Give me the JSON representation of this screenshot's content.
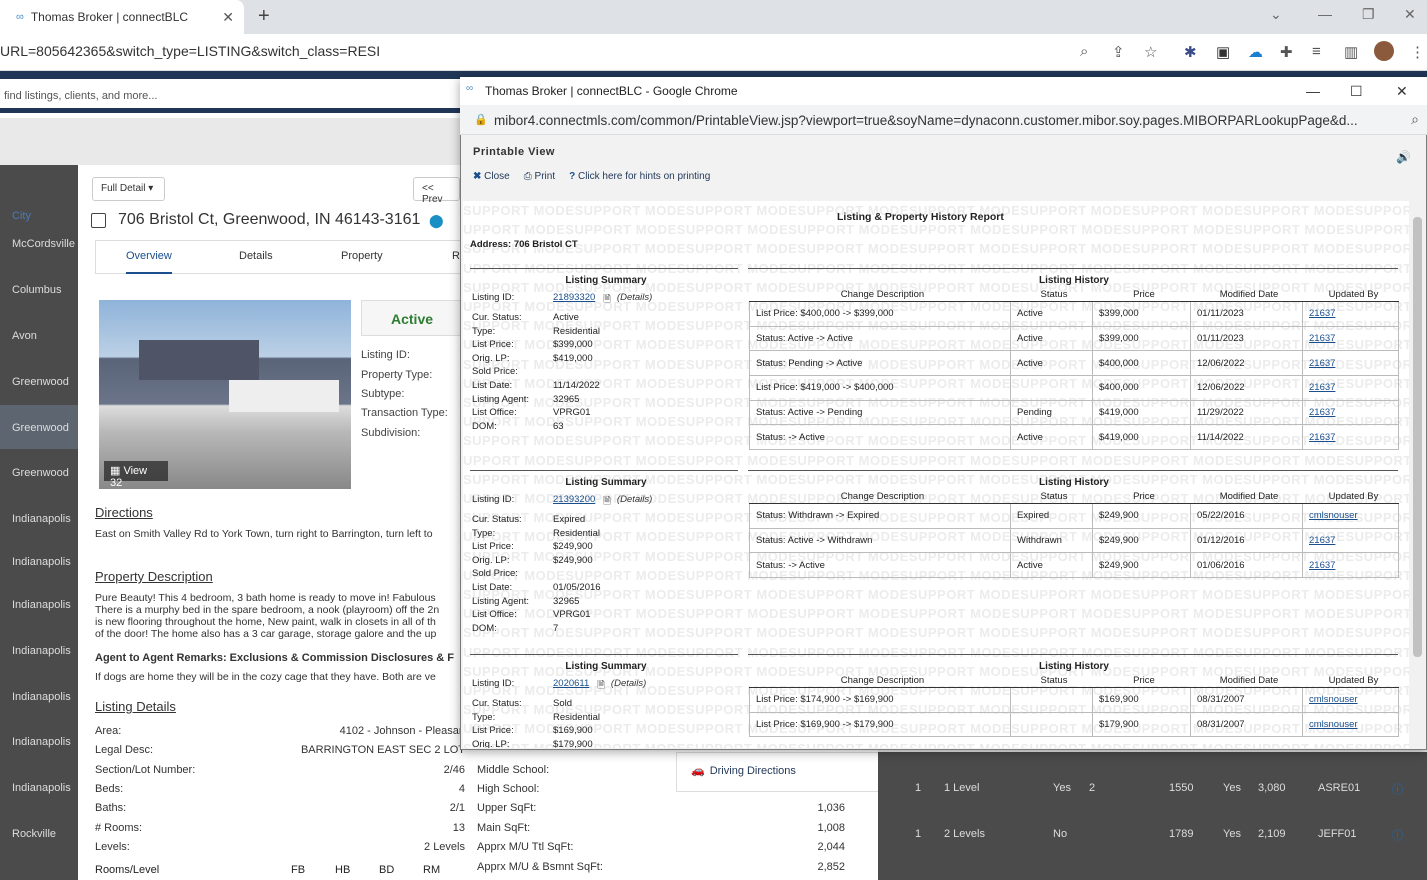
{
  "browser": {
    "tab_title": "Thomas Broker | connectBLC",
    "url": "URL=805642365&switch_type=LISTING&switch_class=RESI"
  },
  "page": {
    "search_placeholder": "find listings, clients, and more...",
    "city_header": "City",
    "cities": [
      "McCordsville",
      "Columbus",
      "Avon",
      "Greenwood",
      "Greenwood",
      "Greenwood",
      "Indianapolis",
      "Indianapolis",
      "Indianapolis",
      "Indianapolis",
      "Indianapolis",
      "Indianapolis",
      "Indianapolis",
      "Rockville"
    ],
    "full_detail_label": "Full Detail",
    "prev_label": "<< Prev",
    "address": "706 Bristol Ct, Greenwood, IN 46143-3161",
    "tabs": [
      "Overview",
      "Details",
      "Property",
      "R"
    ],
    "view_label": "View 32",
    "status": "Active",
    "field_labels": [
      "Listing ID:",
      "Property Type:",
      "Subtype:",
      "Transaction Type:",
      "Subdivision:"
    ],
    "directions_heading": "Directions",
    "directions_text": "East on Smith Valley Rd to York Town, turn right to Barrington, turn left to",
    "prop_desc_heading": "Property Description",
    "prop_desc_lines": [
      "Pure Beauty! This 4 bedroom, 3 bath home is ready to move in! Fabulous",
      "There is a murphy bed in the spare bedroom, a nook (playroom) off the 2n",
      "is new flooring throughout the home, New paint, walk in closets in all of th",
      "of the door! The home also has a 3 car garage, storage galore and the up"
    ],
    "agent_remarks_heading": "Agent to Agent Remarks: Exclusions & Commission Disclosures & F",
    "agent_remarks_text": "If dogs are home they will be in the cozy cage that they have. Both are ve",
    "listing_details_heading": "Listing Details",
    "listing_details": [
      {
        "k": "Area:",
        "v": "4102 - Johnson - Pleasan"
      },
      {
        "k": "Legal Desc:",
        "v": "BARRINGTON EAST SEC 2 LOT"
      },
      {
        "k": "Section/Lot Number:",
        "v": "2/46"
      },
      {
        "k": "Beds:",
        "v": "4"
      },
      {
        "k": "Baths:",
        "v": "2/1"
      },
      {
        "k": "# Rooms:",
        "v": "13"
      },
      {
        "k": "Levels:",
        "v": "2 Levels"
      }
    ],
    "rooms_level_label": "Rooms/Level",
    "rooms_cols": [
      "FB",
      "HB",
      "BD",
      "RM"
    ],
    "right_details": [
      {
        "k": "Middle School:",
        "v": ""
      },
      {
        "k": "High School:",
        "v": ""
      },
      {
        "k": "Upper SqFt:",
        "v": "1,036"
      },
      {
        "k": "Main SqFt:",
        "v": "1,008"
      },
      {
        "k": "Apprx M/U Ttl SqFt:",
        "v": "2,044"
      },
      {
        "k": "Apprx M/U & Bsmnt SqFt:",
        "v": "2,852"
      }
    ],
    "driving_directions": "Driving Directions",
    "grid_rows": [
      {
        "a": "1",
        "b": "1 Level",
        "c": "Yes",
        "d": "2",
        "e": "1550",
        "f": "Yes",
        "g": "3,080",
        "h": "ASRE01"
      },
      {
        "a": "1",
        "b": "2 Levels",
        "c": "No",
        "d": "",
        "e": "1789",
        "f": "Yes",
        "g": "2,109",
        "h": "JEFF01"
      }
    ]
  },
  "popup": {
    "window_title": "Thomas Broker | connectBLC - Google Chrome",
    "url": "mibor4.connectmls.com/common/PrintableView.jsp?viewport=true&soyName=dynaconn.customer.mibor.soy.pages.MIBORPARLookupPage&d...",
    "header": "Printable View",
    "close_label": "Close",
    "print_label": "Print",
    "hints_label": "Click here for hints on printing",
    "report_title": "Listing & Property History Report",
    "address_line": "Address: 706 Bristol CT",
    "watermark": "SUPPORT MODE",
    "summary_heading": "Listing Summary",
    "history_heading": "Listing History",
    "history_cols": [
      "Change Description",
      "Status",
      "Price",
      "Modified Date",
      "Updated By"
    ],
    "summary_labels": [
      "Listing ID:",
      "Cur. Status:",
      "Type:",
      "List Price:",
      "Orig. LP:",
      "Sold Price:",
      "List Date:",
      "Listing Agent:",
      "List Office:",
      "DOM:"
    ],
    "details_label": "(Details)",
    "listings": [
      {
        "summary": [
          "21893320",
          "Active",
          "Residential",
          "$399,000",
          "$419,000",
          "",
          "11/14/2022",
          "32965",
          "VPRG01",
          "63"
        ],
        "history": [
          [
            "List Price: $400,000 -> $399,000",
            "Active",
            "$399,000",
            "01/11/2023",
            "21637"
          ],
          [
            "Status: Active -> Active",
            "Active",
            "$399,000",
            "01/11/2023",
            "21637"
          ],
          [
            "Status: Pending -> Active",
            "Active",
            "$400,000",
            "12/06/2022",
            "21637"
          ],
          [
            "List Price: $419,000 -> $400,000",
            "",
            "$400,000",
            "12/06/2022",
            "21637"
          ],
          [
            "Status: Active -> Pending",
            "Pending",
            "$419,000",
            "11/29/2022",
            "21637"
          ],
          [
            "Status: -> Active",
            "Active",
            "$419,000",
            "11/14/2022",
            "21637"
          ]
        ]
      },
      {
        "summary": [
          "21393200",
          "Expired",
          "Residential",
          "$249,900",
          "$249,900",
          "",
          "01/05/2016",
          "32965",
          "VPRG01",
          "7"
        ],
        "history": [
          [
            "Status: Withdrawn -> Expired",
            "Expired",
            "$249,900",
            "05/22/2016",
            "cmlsnouser"
          ],
          [
            "Status: Active -> Withdrawn",
            "Withdrawn",
            "$249,900",
            "01/12/2016",
            "21637"
          ],
          [
            "Status: -> Active",
            "Active",
            "$249,900",
            "01/06/2016",
            "21637"
          ]
        ]
      },
      {
        "summary": [
          "2020611",
          "Sold",
          "Residential",
          "$169,900",
          "$179,900"
        ],
        "history": [
          [
            "List Price: $174,900 -> $169,900",
            "",
            "$169,900",
            "08/31/2007",
            "cmlsnouser"
          ],
          [
            "List Price: $169,900 -> $179,900",
            "",
            "$179,900",
            "08/31/2007",
            "cmlsnouser"
          ]
        ]
      }
    ]
  }
}
